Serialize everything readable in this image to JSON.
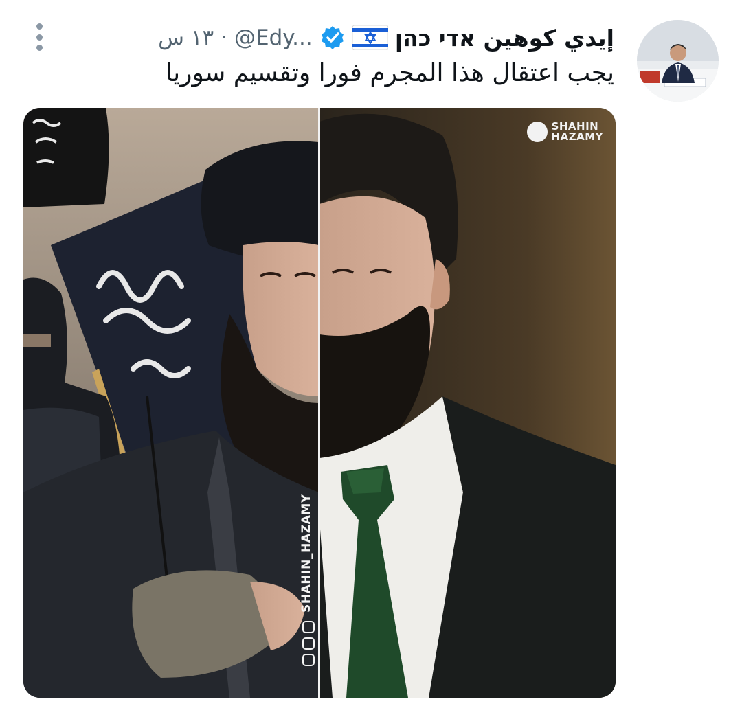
{
  "tweet": {
    "display_name": "إيدي كوهين אדי כהן",
    "flag_icon": "israel-flag-icon",
    "verified_icon": "verified-badge-icon",
    "handle": "@Edy...",
    "separator": "·",
    "time": "١٣ س",
    "text": "يجب اعتقال هذا المجرم فورا وتقسيم سوريا",
    "more_icon": "more-options-icon",
    "accent_color": "#1d9bf0",
    "secondary_text_color": "#536471"
  },
  "media": {
    "watermark_top_line1": "SHAHIN",
    "watermark_top_line2": "HAZAMY",
    "watermark_side": "SHAHIN_HAZAMY"
  }
}
